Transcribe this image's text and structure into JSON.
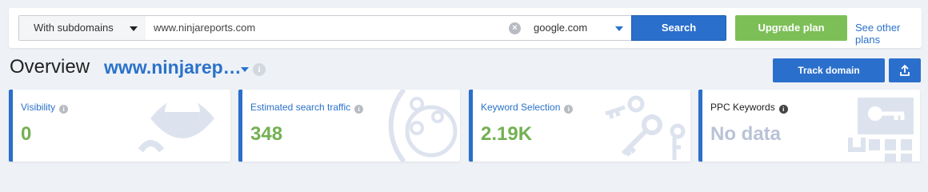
{
  "search": {
    "scope": "With subdomains",
    "domain": "www.ninjareports.com",
    "engine": "google.com",
    "search_label": "Search",
    "upgrade_label": "Upgrade plan",
    "other_plans_label": "See other plans"
  },
  "header": {
    "title": "Overview",
    "domain": "www.ninjarep…",
    "track_label": "Track domain"
  },
  "cards": [
    {
      "label": "Visibility",
      "value": "0"
    },
    {
      "label": "Estimated search traffic",
      "value": "348"
    },
    {
      "label": "Keyword Selection",
      "value": "2.19K"
    },
    {
      "label": "PPC Keywords",
      "value": "No data"
    }
  ],
  "icons": {
    "clear": "clear-icon",
    "info": "info-icon",
    "export": "export-icon",
    "visibility_art": "eye-icon",
    "traffic_art": "orbit-icon",
    "keywords_art": "keys-icon",
    "ppc_art": "key-blocks-icon"
  },
  "colors": {
    "accent": "#2a6fcb",
    "upgrade": "#7cbf57",
    "value": "#73b052",
    "muted": "#b9c3d6",
    "background": "#eef1f6"
  }
}
